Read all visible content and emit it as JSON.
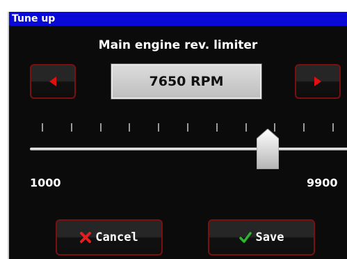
{
  "window": {
    "title": "Tune up"
  },
  "setting": {
    "label": "Main engine rev. limiter",
    "value_display": "7650 RPM",
    "value": 7650,
    "unit": "RPM"
  },
  "slider": {
    "min": 1000,
    "max": 9900,
    "min_label": "1000",
    "max_label": "9900",
    "tick_count": 11
  },
  "buttons": {
    "decrease_icon": "triangle-left-icon",
    "increase_icon": "triangle-right-icon",
    "cancel": {
      "label": "Cancel",
      "icon": "x-icon",
      "icon_color": "#e02020"
    },
    "save": {
      "label": "Save",
      "icon": "checkmark-icon",
      "icon_color": "#2fb52f"
    }
  },
  "colors": {
    "title_bar": "#0a0ad8",
    "background": "#0b0b0b",
    "button_border": "#7a1010",
    "arrow": "#e01010"
  }
}
